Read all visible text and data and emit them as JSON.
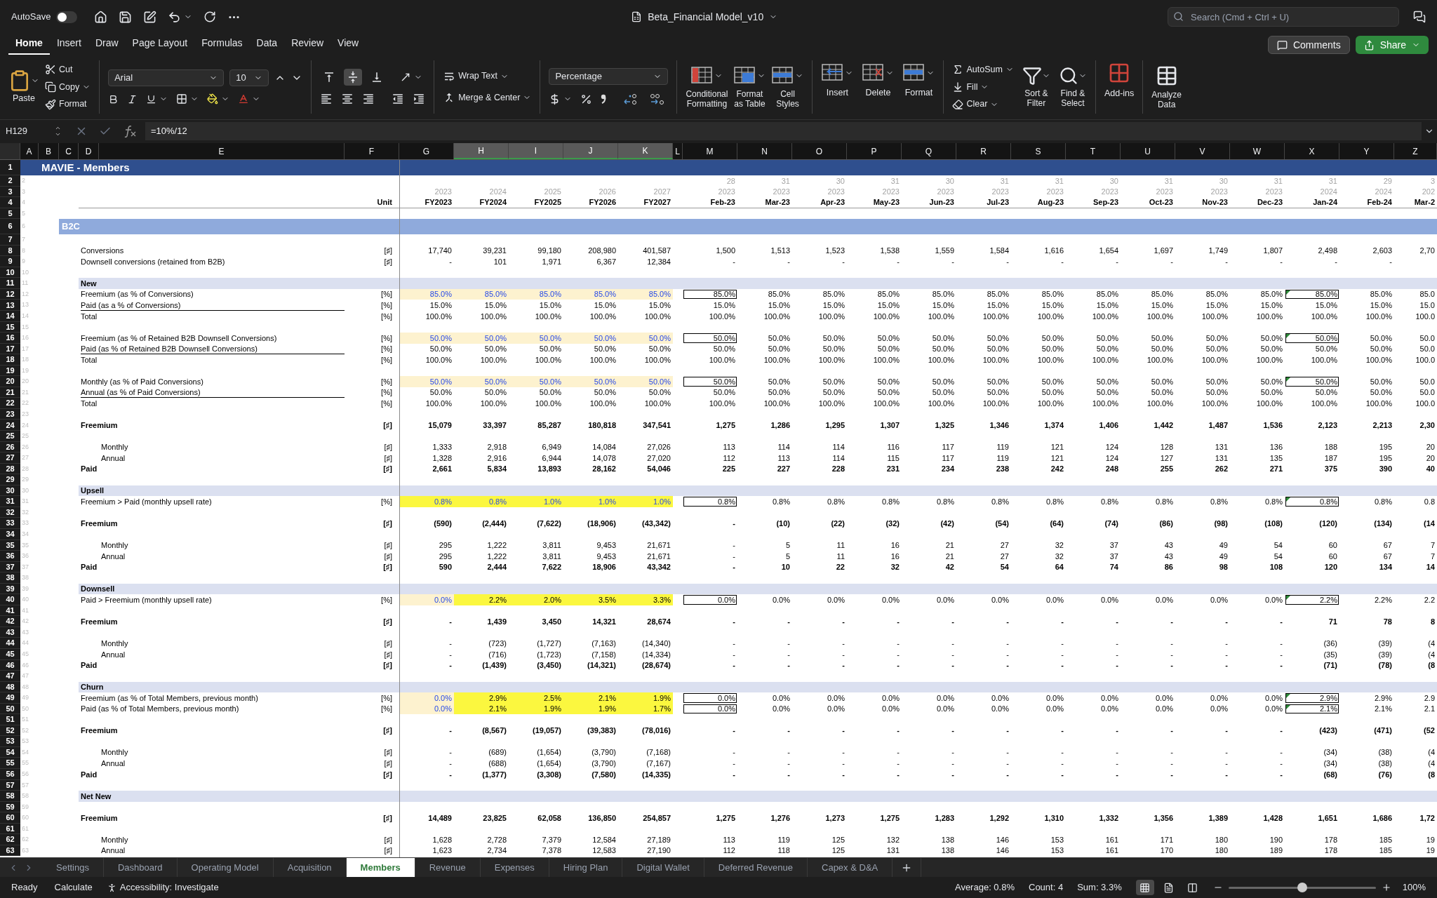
{
  "title_bar": {
    "autosave": {
      "label": "AutoSave",
      "on": false
    },
    "file_name": "Beta_Financial Model_v10",
    "search": {
      "placeholder": "Search (Cmd + Ctrl + U)"
    }
  },
  "ribbon_tabs": [
    {
      "label": "Home",
      "selected": true
    },
    {
      "label": "Insert",
      "selected": false
    },
    {
      "label": "Draw",
      "selected": false
    },
    {
      "label": "Page Layout",
      "selected": false
    },
    {
      "label": "Formulas",
      "selected": false
    },
    {
      "label": "Data",
      "selected": false
    },
    {
      "label": "Review",
      "selected": false
    },
    {
      "label": "View",
      "selected": false
    }
  ],
  "comments_button": "Comments",
  "share_button": "Share",
  "ribbon": {
    "clipboard": {
      "paste": "Paste",
      "cut": "Cut",
      "copy": "Copy",
      "format": "Format"
    },
    "font": {
      "name": "Arial",
      "size": "10"
    },
    "alignment": {
      "vertical": [
        {
          "selected": false
        },
        {
          "selected": true
        },
        {
          "selected": false
        }
      ],
      "wrap": "Wrap Text",
      "merge": "Merge & Center"
    },
    "number": {
      "format": "Percentage"
    },
    "styles": [
      [
        "Conditional",
        "Formatting"
      ],
      [
        "Format",
        "as Table"
      ],
      [
        "Cell",
        "Styles"
      ]
    ],
    "cells": [
      "Insert",
      "Delete",
      "Format"
    ],
    "editing": {
      "autosum": "AutoSum",
      "fill": "Fill",
      "clear": "Clear",
      "sort": [
        "Sort &",
        "Filter"
      ],
      "find": [
        "Find &",
        "Select"
      ]
    },
    "addins": "Add-ins",
    "analyze": [
      "Analyze",
      "Data"
    ]
  },
  "formula_bar": {
    "name_box": "H129",
    "formula": "=10%/12"
  },
  "columns": [
    {
      "label": "A",
      "selected": false
    },
    {
      "label": "B",
      "selected": false
    },
    {
      "label": "C",
      "selected": false
    },
    {
      "label": "D",
      "selected": false
    },
    {
      "label": "E",
      "selected": false
    },
    {
      "label": "F",
      "selected": false
    },
    {
      "label": "G",
      "selected": false
    },
    {
      "label": "H",
      "selected": true
    },
    {
      "label": "I",
      "selected": true
    },
    {
      "label": "J",
      "selected": true
    },
    {
      "label": "K",
      "selected": true
    },
    {
      "label": "L",
      "selected": false
    },
    {
      "label": "M",
      "selected": false
    },
    {
      "label": "N",
      "selected": false
    },
    {
      "label": "O",
      "selected": false
    },
    {
      "label": "P",
      "selected": false
    },
    {
      "label": "Q",
      "selected": false
    },
    {
      "label": "R",
      "selected": false
    },
    {
      "label": "S",
      "selected": false
    },
    {
      "label": "T",
      "selected": false
    },
    {
      "label": "U",
      "selected": false
    },
    {
      "label": "V",
      "selected": false
    },
    {
      "label": "W",
      "selected": false
    },
    {
      "label": "X",
      "selected": false
    },
    {
      "label": "Y",
      "selected": false
    },
    {
      "label": "Z",
      "selected": false
    }
  ],
  "rows": [
    {
      "n": "1",
      "kind": "title",
      "label": "MAVIE - Members"
    },
    {
      "n": "2",
      "a": "2",
      "kind": "days",
      "monthly": [
        "28",
        "31",
        "30",
        "31",
        "30",
        "31",
        "31",
        "30",
        "31",
        "30",
        "31",
        "31",
        "29",
        "3"
      ]
    },
    {
      "n": "3",
      "a": "3",
      "kind": "years",
      "annual": [
        "2023",
        "2024",
        "2025",
        "2026",
        "2027"
      ],
      "monthly": [
        "2023",
        "2023",
        "2023",
        "2023",
        "2023",
        "2023",
        "2023",
        "2023",
        "2023",
        "2023",
        "2023",
        "2024",
        "2024",
        "202"
      ]
    },
    {
      "n": "4",
      "a": "4",
      "kind": "periods",
      "unit": "Unit",
      "annual": [
        "FY2023",
        "FY2024",
        "FY2025",
        "FY2026",
        "FY2027"
      ],
      "monthly": [
        "Feb-23",
        "Mar-23",
        "Apr-23",
        "May-23",
        "Jun-23",
        "Jul-23",
        "Aug-23",
        "Sep-23",
        "Oct-23",
        "Nov-23",
        "Dec-23",
        "Jan-24",
        "Feb-24",
        "Mar-2"
      ]
    },
    {
      "n": "5",
      "a": "5",
      "kind": "blank"
    },
    {
      "n": "6",
      "a": "6",
      "kind": "band",
      "label": "B2C"
    },
    {
      "n": "7",
      "a": "7",
      "kind": "blank"
    },
    {
      "n": "8",
      "a": "8",
      "kind": "line",
      "label": "Conversions",
      "unit": "[♯]",
      "annual": [
        "17,740",
        "39,231",
        "99,180",
        "208,980",
        "401,587"
      ],
      "monthly": [
        "1,500",
        "1,513",
        "1,523",
        "1,538",
        "1,559",
        "1,584",
        "1,616",
        "1,654",
        "1,697",
        "1,749",
        "1,807",
        "2,498",
        "2,603",
        "2,70"
      ]
    },
    {
      "n": "9",
      "a": "9",
      "kind": "line",
      "label": "Downsell conversions (retained from B2B)",
      "unit": "[♯]",
      "annual": [
        "-",
        "101",
        "1,971",
        "6,367",
        "12,384"
      ],
      "monthly": [
        "-",
        "-",
        "-",
        "-",
        "-",
        "-",
        "-",
        "-",
        "-",
        "-",
        "-",
        "-",
        "-"
      ]
    },
    {
      "n": "10",
      "a": "10",
      "kind": "blank"
    },
    {
      "n": "11",
      "a": "11",
      "kind": "section",
      "label": "New"
    },
    {
      "n": "12",
      "a": "12",
      "kind": "line",
      "label": "Freemium (as % of Conversions)",
      "unit": "[%]",
      "annual": [
        "85.0%",
        "85.0%",
        "85.0%",
        "85.0%",
        "85.0%"
      ],
      "monthly": [
        "85.0%",
        "85.0%",
        "85.0%",
        "85.0%",
        "85.0%",
        "85.0%",
        "85.0%",
        "85.0%",
        "85.0%",
        "85.0%",
        "85.0%",
        "85.0%",
        "85.0%",
        "85.0"
      ],
      "input_cells": [
        {
          "kind": "assumption"
        },
        {
          "kind": "assumption"
        },
        {
          "kind": "assumption"
        },
        {
          "kind": "assumption"
        },
        {
          "kind": "assumption"
        }
      ],
      "flagged": true
    },
    {
      "n": "13",
      "a": "13",
      "kind": "line",
      "label": "Paid (as a % of Conversions)",
      "unit": "[%]",
      "underlined": true,
      "annual": [
        "15.0%",
        "15.0%",
        "15.0%",
        "15.0%",
        "15.0%"
      ],
      "monthly": [
        "15.0%",
        "15.0%",
        "15.0%",
        "15.0%",
        "15.0%",
        "15.0%",
        "15.0%",
        "15.0%",
        "15.0%",
        "15.0%",
        "15.0%",
        "15.0%",
        "15.0%",
        "15.0"
      ]
    },
    {
      "n": "14",
      "a": "14",
      "kind": "line",
      "label": "Total",
      "unit": "[%]",
      "annual": [
        "100.0%",
        "100.0%",
        "100.0%",
        "100.0%",
        "100.0%"
      ],
      "monthly": [
        "100.0%",
        "100.0%",
        "100.0%",
        "100.0%",
        "100.0%",
        "100.0%",
        "100.0%",
        "100.0%",
        "100.0%",
        "100.0%",
        "100.0%",
        "100.0%",
        "100.0%",
        "100.0"
      ]
    },
    {
      "n": "15",
      "a": "15",
      "kind": "blank"
    },
    {
      "n": "16",
      "a": "16",
      "kind": "line",
      "label": "Freemium (as % of Retained B2B Downsell Conversions)",
      "unit": "[%]",
      "annual": [
        "50.0%",
        "50.0%",
        "50.0%",
        "50.0%",
        "50.0%"
      ],
      "monthly": [
        "50.0%",
        "50.0%",
        "50.0%",
        "50.0%",
        "50.0%",
        "50.0%",
        "50.0%",
        "50.0%",
        "50.0%",
        "50.0%",
        "50.0%",
        "50.0%",
        "50.0%",
        "50.0"
      ],
      "input_cells": [
        {
          "kind": "assumption"
        },
        {
          "kind": "assumption"
        },
        {
          "kind": "assumption"
        },
        {
          "kind": "assumption"
        },
        {
          "kind": "assumption"
        }
      ],
      "flagged": true
    },
    {
      "n": "17",
      "a": "17",
      "kind": "line",
      "label": "Paid (as % of Retained B2B Downsell Conversions)",
      "unit": "[%]",
      "underlined": true,
      "annual": [
        "50.0%",
        "50.0%",
        "50.0%",
        "50.0%",
        "50.0%"
      ],
      "monthly": [
        "50.0%",
        "50.0%",
        "50.0%",
        "50.0%",
        "50.0%",
        "50.0%",
        "50.0%",
        "50.0%",
        "50.0%",
        "50.0%",
        "50.0%",
        "50.0%",
        "50.0%",
        "50.0"
      ]
    },
    {
      "n": "18",
      "a": "18",
      "kind": "line",
      "label": "Total",
      "unit": "[%]",
      "annual": [
        "100.0%",
        "100.0%",
        "100.0%",
        "100.0%",
        "100.0%"
      ],
      "monthly": [
        "100.0%",
        "100.0%",
        "100.0%",
        "100.0%",
        "100.0%",
        "100.0%",
        "100.0%",
        "100.0%",
        "100.0%",
        "100.0%",
        "100.0%",
        "100.0%",
        "100.0%",
        "100.0"
      ]
    },
    {
      "n": "19",
      "a": "19",
      "kind": "blank"
    },
    {
      "n": "20",
      "a": "20",
      "kind": "line",
      "label": "Monthly (as % of Paid Conversions)",
      "unit": "[%]",
      "annual": [
        "50.0%",
        "50.0%",
        "50.0%",
        "50.0%",
        "50.0%"
      ],
      "monthly": [
        "50.0%",
        "50.0%",
        "50.0%",
        "50.0%",
        "50.0%",
        "50.0%",
        "50.0%",
        "50.0%",
        "50.0%",
        "50.0%",
        "50.0%",
        "50.0%",
        "50.0%",
        "50.0"
      ],
      "input_cells": [
        {
          "kind": "assumption"
        },
        {
          "kind": "assumption"
        },
        {
          "kind": "assumption"
        },
        {
          "kind": "assumption"
        },
        {
          "kind": "assumption"
        }
      ],
      "flagged": true
    },
    {
      "n": "21",
      "a": "21",
      "kind": "line",
      "label": "Annual (as % of Paid Conversions)",
      "unit": "[%]",
      "underlined": true,
      "annual": [
        "50.0%",
        "50.0%",
        "50.0%",
        "50.0%",
        "50.0%"
      ],
      "monthly": [
        "50.0%",
        "50.0%",
        "50.0%",
        "50.0%",
        "50.0%",
        "50.0%",
        "50.0%",
        "50.0%",
        "50.0%",
        "50.0%",
        "50.0%",
        "50.0%",
        "50.0%",
        "50.0"
      ]
    },
    {
      "n": "22",
      "a": "22",
      "kind": "line",
      "label": "Total",
      "unit": "[%]",
      "annual": [
        "100.0%",
        "100.0%",
        "100.0%",
        "100.0%",
        "100.0%"
      ],
      "monthly": [
        "100.0%",
        "100.0%",
        "100.0%",
        "100.0%",
        "100.0%",
        "100.0%",
        "100.0%",
        "100.0%",
        "100.0%",
        "100.0%",
        "100.0%",
        "100.0%",
        "100.0%",
        "100.0"
      ]
    },
    {
      "n": "23",
      "a": "23",
      "kind": "blank"
    },
    {
      "n": "24",
      "a": "24",
      "kind": "total",
      "label": "Freemium",
      "unit": "[♯]",
      "annual": [
        "15,079",
        "33,397",
        "85,287",
        "180,818",
        "347,541"
      ],
      "monthly": [
        "1,275",
        "1,286",
        "1,295",
        "1,307",
        "1,325",
        "1,346",
        "1,374",
        "1,406",
        "1,442",
        "1,487",
        "1,536",
        "2,123",
        "2,213",
        "2,30"
      ]
    },
    {
      "n": "25",
      "a": "25",
      "kind": "blank"
    },
    {
      "n": "26",
      "a": "26",
      "kind": "sub",
      "label": "Monthly",
      "unit": "[♯]",
      "annual": [
        "1,333",
        "2,918",
        "6,949",
        "14,084",
        "27,026"
      ],
      "monthly": [
        "113",
        "114",
        "114",
        "116",
        "117",
        "119",
        "121",
        "124",
        "128",
        "131",
        "136",
        "188",
        "195",
        "20"
      ]
    },
    {
      "n": "27",
      "a": "27",
      "kind": "sub",
      "label": "Annual",
      "unit": "[♯]",
      "annual": [
        "1,328",
        "2,916",
        "6,944",
        "14,078",
        "27,020"
      ],
      "monthly": [
        "112",
        "113",
        "114",
        "115",
        "117",
        "119",
        "121",
        "124",
        "127",
        "131",
        "135",
        "187",
        "195",
        "20"
      ]
    },
    {
      "n": "28",
      "a": "28",
      "kind": "total",
      "label": "Paid",
      "unit": "[♯]",
      "annual": [
        "2,661",
        "5,834",
        "13,893",
        "28,162",
        "54,046"
      ],
      "monthly": [
        "225",
        "227",
        "228",
        "231",
        "234",
        "238",
        "242",
        "248",
        "255",
        "262",
        "271",
        "375",
        "390",
        "40"
      ]
    },
    {
      "n": "29",
      "a": "29",
      "kind": "blank"
    },
    {
      "n": "30",
      "a": "30",
      "kind": "section",
      "label": "Upsell"
    },
    {
      "n": "31",
      "a": "31",
      "kind": "line",
      "label": "Freemium > Paid (monthly upsell rate)",
      "unit": "[%]",
      "annual": [
        "0.8%",
        "0.8%",
        "1.0%",
        "1.0%",
        "1.0%"
      ],
      "monthly": [
        "0.8%",
        "0.8%",
        "0.8%",
        "0.8%",
        "0.8%",
        "0.8%",
        "0.8%",
        "0.8%",
        "0.8%",
        "0.8%",
        "0.8%",
        "0.8%",
        "0.8%",
        "0.8"
      ],
      "input_cells": [
        {
          "kind": "driver"
        },
        {
          "kind": "driver"
        },
        {
          "kind": "driver"
        },
        {
          "kind": "driver"
        },
        {
          "kind": "driver"
        }
      ],
      "flagged": true
    },
    {
      "n": "32",
      "a": "32",
      "kind": "blank"
    },
    {
      "n": "33",
      "a": "33",
      "kind": "total",
      "label": "Freemium",
      "unit": "[♯]",
      "annual": [
        "(590)",
        "(2,444)",
        "(7,622)",
        "(18,906)",
        "(43,342)"
      ],
      "monthly": [
        "-",
        "(10)",
        "(22)",
        "(32)",
        "(42)",
        "(54)",
        "(64)",
        "(74)",
        "(86)",
        "(98)",
        "(108)",
        "(120)",
        "(134)",
        "(14"
      ]
    },
    {
      "n": "34",
      "a": "34",
      "kind": "blank"
    },
    {
      "n": "35",
      "a": "35",
      "kind": "sub",
      "label": "Monthly",
      "unit": "[♯]",
      "annual": [
        "295",
        "1,222",
        "3,811",
        "9,453",
        "21,671"
      ],
      "monthly": [
        "-",
        "5",
        "11",
        "16",
        "21",
        "27",
        "32",
        "37",
        "43",
        "49",
        "54",
        "60",
        "67",
        "7"
      ]
    },
    {
      "n": "36",
      "a": "36",
      "kind": "sub",
      "label": "Annual",
      "unit": "[♯]",
      "annual": [
        "295",
        "1,222",
        "3,811",
        "9,453",
        "21,671"
      ],
      "monthly": [
        "-",
        "5",
        "11",
        "16",
        "21",
        "27",
        "32",
        "37",
        "43",
        "49",
        "54",
        "60",
        "67",
        "7"
      ]
    },
    {
      "n": "37",
      "a": "37",
      "kind": "total",
      "label": "Paid",
      "unit": "[♯]",
      "annual": [
        "590",
        "2,444",
        "7,622",
        "18,906",
        "43,342"
      ],
      "monthly": [
        "-",
        "10",
        "22",
        "32",
        "42",
        "54",
        "64",
        "74",
        "86",
        "98",
        "108",
        "120",
        "134",
        "14"
      ]
    },
    {
      "n": "38",
      "a": "38",
      "kind": "blank"
    },
    {
      "n": "39",
      "a": "39",
      "kind": "section",
      "label": "Downsell"
    },
    {
      "n": "40",
      "a": "40",
      "kind": "line",
      "label": "Paid > Freemium (monthly upsell rate)",
      "unit": "[%]",
      "annual": [
        "0.0%",
        "2.2%",
        "2.0%",
        "3.5%",
        "3.3%"
      ],
      "monthly": [
        "0.0%",
        "0.0%",
        "0.0%",
        "0.0%",
        "0.0%",
        "0.0%",
        "0.0%",
        "0.0%",
        "0.0%",
        "0.0%",
        "0.0%",
        "2.2%",
        "2.2%",
        "2.2"
      ],
      "input_cells": [
        {
          "kind": "assumption"
        },
        {
          "kind": "override"
        },
        {
          "kind": "override"
        },
        {
          "kind": "override"
        },
        {
          "kind": "override"
        }
      ],
      "flagged": true
    },
    {
      "n": "41",
      "a": "41",
      "kind": "blank"
    },
    {
      "n": "42",
      "a": "42",
      "kind": "total",
      "label": "Freemium",
      "unit": "[♯]",
      "annual": [
        "-",
        "1,439",
        "3,450",
        "14,321",
        "28,674"
      ],
      "monthly": [
        "-",
        "-",
        "-",
        "-",
        "-",
        "-",
        "-",
        "-",
        "-",
        "-",
        "-",
        "71",
        "78",
        "8"
      ]
    },
    {
      "n": "43",
      "a": "43",
      "kind": "blank"
    },
    {
      "n": "44",
      "a": "44",
      "kind": "sub",
      "label": "Monthly",
      "unit": "[♯]",
      "annual": [
        "-",
        "(723)",
        "(1,727)",
        "(7,163)",
        "(14,340)"
      ],
      "monthly": [
        "-",
        "-",
        "-",
        "-",
        "-",
        "-",
        "-",
        "-",
        "-",
        "-",
        "-",
        "(36)",
        "(39)",
        "(4"
      ]
    },
    {
      "n": "45",
      "a": "45",
      "kind": "sub",
      "label": "Annual",
      "unit": "[♯]",
      "annual": [
        "-",
        "(716)",
        "(1,723)",
        "(7,158)",
        "(14,334)"
      ],
      "monthly": [
        "-",
        "-",
        "-",
        "-",
        "-",
        "-",
        "-",
        "-",
        "-",
        "-",
        "-",
        "(35)",
        "(39)",
        "(4"
      ]
    },
    {
      "n": "46",
      "a": "46",
      "kind": "total",
      "label": "Paid",
      "unit": "[♯]",
      "annual": [
        "-",
        "(1,439)",
        "(3,450)",
        "(14,321)",
        "(28,674)"
      ],
      "monthly": [
        "-",
        "-",
        "-",
        "-",
        "-",
        "-",
        "-",
        "-",
        "-",
        "-",
        "-",
        "(71)",
        "(78)",
        "(8"
      ]
    },
    {
      "n": "47",
      "a": "47",
      "kind": "blank"
    },
    {
      "n": "48",
      "a": "48",
      "kind": "section",
      "label": "Churn"
    },
    {
      "n": "49",
      "a": "49",
      "kind": "line",
      "label": "Freemium (as % of Total Members, previous month)",
      "unit": "[%]",
      "annual": [
        "0.0%",
        "2.9%",
        "2.5%",
        "2.1%",
        "1.9%"
      ],
      "monthly": [
        "0.0%",
        "0.0%",
        "0.0%",
        "0.0%",
        "0.0%",
        "0.0%",
        "0.0%",
        "0.0%",
        "0.0%",
        "0.0%",
        "0.0%",
        "2.9%",
        "2.9%",
        "2.9"
      ],
      "input_cells": [
        {
          "kind": "assumption"
        },
        {
          "kind": "override"
        },
        {
          "kind": "override"
        },
        {
          "kind": "override"
        },
        {
          "kind": "override"
        }
      ],
      "flagged": true
    },
    {
      "n": "50",
      "a": "50",
      "kind": "line",
      "label": "Paid (as % of Total Members, previous month)",
      "unit": "[%]",
      "annual": [
        "0.0%",
        "2.1%",
        "1.9%",
        "1.9%",
        "1.7%"
      ],
      "monthly": [
        "0.0%",
        "0.0%",
        "0.0%",
        "0.0%",
        "0.0%",
        "0.0%",
        "0.0%",
        "0.0%",
        "0.0%",
        "0.0%",
        "0.0%",
        "2.1%",
        "2.1%",
        "2.1"
      ],
      "input_cells": [
        {
          "kind": "assumption"
        },
        {
          "kind": "override"
        },
        {
          "kind": "override"
        },
        {
          "kind": "override"
        },
        {
          "kind": "override"
        }
      ],
      "flagged": true
    },
    {
      "n": "51",
      "a": "51",
      "kind": "blank"
    },
    {
      "n": "52",
      "a": "52",
      "kind": "total",
      "label": "Freemium",
      "unit": "[♯]",
      "annual": [
        "-",
        "(8,567)",
        "(19,057)",
        "(39,383)",
        "(78,016)"
      ],
      "monthly": [
        "-",
        "-",
        "-",
        "-",
        "-",
        "-",
        "-",
        "-",
        "-",
        "-",
        "-",
        "(423)",
        "(471)",
        "(52"
      ]
    },
    {
      "n": "53",
      "a": "53",
      "kind": "blank"
    },
    {
      "n": "54",
      "a": "54",
      "kind": "sub",
      "label": "Monthly",
      "unit": "[♯]",
      "annual": [
        "-",
        "(689)",
        "(1,654)",
        "(3,790)",
        "(7,168)"
      ],
      "monthly": [
        "-",
        "-",
        "-",
        "-",
        "-",
        "-",
        "-",
        "-",
        "-",
        "-",
        "-",
        "(34)",
        "(38)",
        "(4"
      ]
    },
    {
      "n": "55",
      "a": "55",
      "kind": "sub",
      "label": "Annual",
      "unit": "[♯]",
      "annual": [
        "-",
        "(688)",
        "(1,654)",
        "(3,790)",
        "(7,167)"
      ],
      "monthly": [
        "-",
        "-",
        "-",
        "-",
        "-",
        "-",
        "-",
        "-",
        "-",
        "-",
        "-",
        "(34)",
        "(38)",
        "(4"
      ]
    },
    {
      "n": "56",
      "a": "56",
      "kind": "total",
      "label": "Paid",
      "unit": "[♯]",
      "annual": [
        "-",
        "(1,377)",
        "(3,308)",
        "(7,580)",
        "(14,335)"
      ],
      "monthly": [
        "-",
        "-",
        "-",
        "-",
        "-",
        "-",
        "-",
        "-",
        "-",
        "-",
        "-",
        "(68)",
        "(76)",
        "(8"
      ]
    },
    {
      "n": "57",
      "a": "57",
      "kind": "blank"
    },
    {
      "n": "58",
      "a": "58",
      "kind": "section",
      "label": "Net New"
    },
    {
      "n": "59",
      "a": "59",
      "kind": "blank"
    },
    {
      "n": "60",
      "a": "60",
      "kind": "total",
      "label": "Freemium",
      "unit": "[♯]",
      "annual": [
        "14,489",
        "23,825",
        "62,058",
        "136,850",
        "254,857"
      ],
      "monthly": [
        "1,275",
        "1,276",
        "1,273",
        "1,275",
        "1,283",
        "1,292",
        "1,310",
        "1,332",
        "1,356",
        "1,389",
        "1,428",
        "1,651",
        "1,686",
        "1,72"
      ]
    },
    {
      "n": "61",
      "a": "61",
      "kind": "blank"
    },
    {
      "n": "62",
      "a": "62",
      "kind": "sub",
      "label": "Monthly",
      "unit": "[♯]",
      "annual": [
        "1,628",
        "2,728",
        "7,379",
        "12,584",
        "27,189"
      ],
      "monthly": [
        "113",
        "119",
        "125",
        "132",
        "138",
        "146",
        "153",
        "161",
        "171",
        "180",
        "190",
        "178",
        "185",
        "19"
      ]
    },
    {
      "n": "63",
      "a": "63",
      "kind": "sub",
      "label": "Annual",
      "unit": "[♯]",
      "annual": [
        "1,623",
        "2,734",
        "7,378",
        "12,583",
        "27,190"
      ],
      "monthly": [
        "112",
        "118",
        "125",
        "131",
        "138",
        "146",
        "153",
        "161",
        "170",
        "180",
        "189",
        "178",
        "185",
        "19"
      ]
    }
  ],
  "sheets": [
    {
      "label": "Settings",
      "selected": false
    },
    {
      "label": "Dashboard",
      "selected": false
    },
    {
      "label": "Operating Model",
      "selected": false
    },
    {
      "label": "Acquisition",
      "selected": false
    },
    {
      "label": "Members",
      "selected": true
    },
    {
      "label": "Revenue",
      "selected": false
    },
    {
      "label": "Expenses",
      "selected": false
    },
    {
      "label": "Hiring Plan",
      "selected": false
    },
    {
      "label": "Digital Wallet",
      "selected": false
    },
    {
      "label": "Deferred Revenue",
      "selected": false
    },
    {
      "label": "Capex & D&A",
      "selected": false
    }
  ],
  "status_bar": {
    "left": [
      "Ready",
      "Calculate"
    ],
    "accessibility": "Accessibility: Investigate",
    "stats": [
      "Average: 0.8%",
      "Count: 4",
      "Sum: 3.3%"
    ],
    "views": [
      {
        "selected": true
      },
      {
        "selected": false
      },
      {
        "selected": false
      }
    ],
    "zoom": {
      "level": 0.5,
      "label": "100%"
    }
  }
}
